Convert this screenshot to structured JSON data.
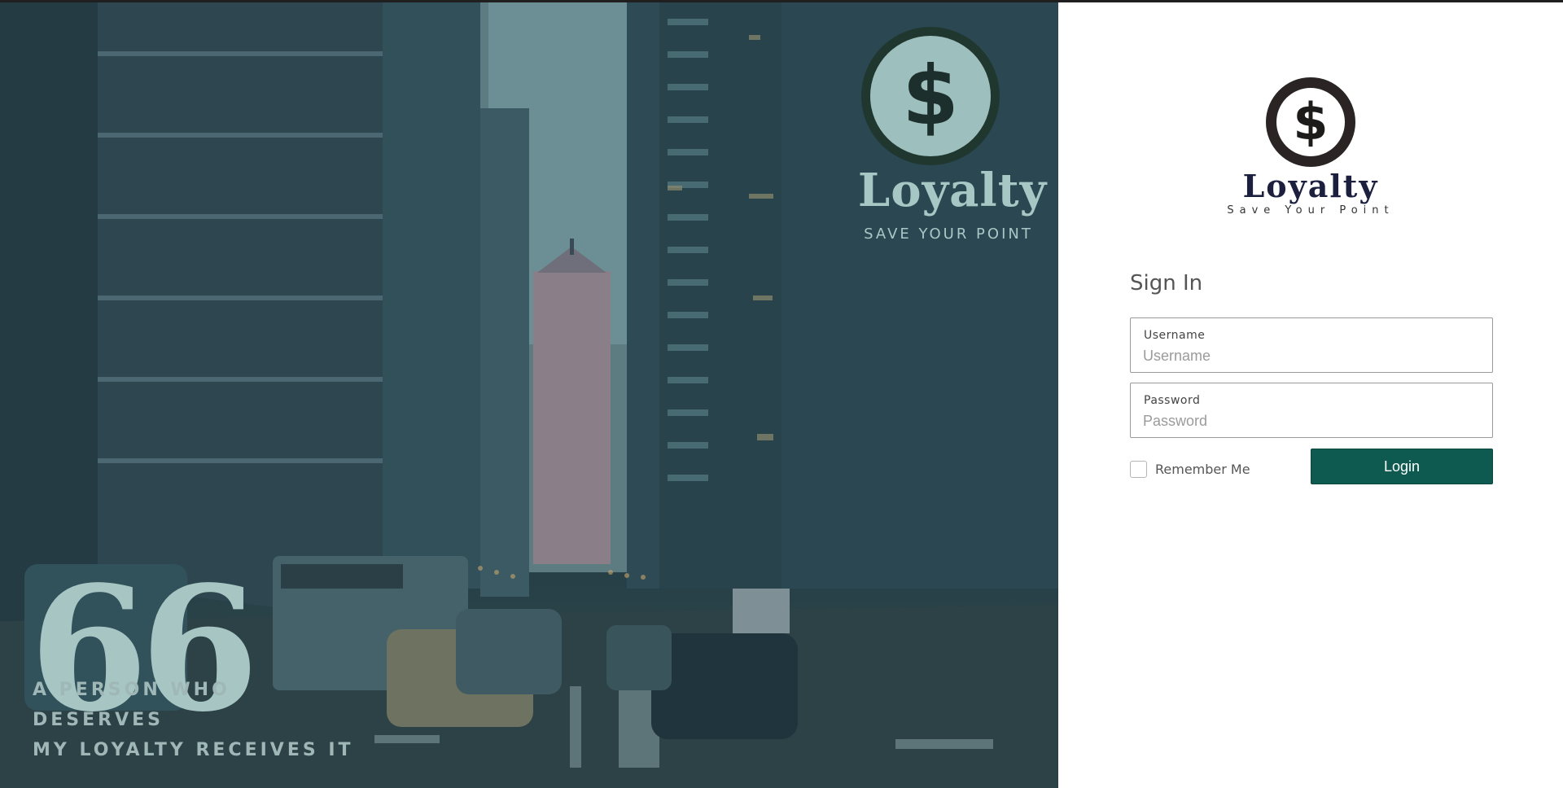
{
  "hero": {
    "brand_name": "Loyalty",
    "tagline": "SAVE YOUR POINT",
    "quote_lines": [
      "A PERSON WHO",
      "DESERVES",
      "MY LOYALTY RECEIVES IT"
    ],
    "logo_icon": "dollar-coin-icon",
    "logo_symbol": "$",
    "quote_symbol": "66",
    "overlay_color": "#2c4a52"
  },
  "brand": {
    "logo_icon": "dollar-coin-icon",
    "logo_symbol": "$",
    "name": "Loyalty",
    "tagline": "Save Your Point"
  },
  "form": {
    "title": "Sign In",
    "username": {
      "label": "Username",
      "placeholder": "Username",
      "value": ""
    },
    "password": {
      "label": "Password",
      "placeholder": "Password",
      "value": ""
    },
    "remember_label": "Remember Me",
    "remember_checked": false,
    "login_label": "Login",
    "accent_color": "#0f5a50"
  }
}
